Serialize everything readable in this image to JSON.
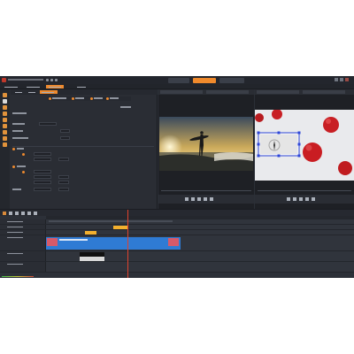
{
  "app": {
    "title": "",
    "top_tabs": [
      {
        "label": "",
        "active": false
      },
      {
        "label": "",
        "active": true
      },
      {
        "label": "",
        "active": false
      }
    ],
    "accent_color": "#ee8a2e"
  },
  "left_panel": {
    "tabs": [
      {
        "label": ""
      },
      {
        "label": ""
      },
      {
        "label": ""
      },
      {
        "label": ""
      }
    ],
    "subtabs": [
      {
        "label": ""
      },
      {
        "label": ""
      },
      {
        "label": ""
      }
    ]
  },
  "source_preview": {
    "tabs": [
      {
        "label": ""
      },
      {
        "label": ""
      }
    ],
    "image": "surfer-silhouette-sunset-ocean"
  },
  "effect_preview": {
    "tabs": [
      {
        "label": ""
      },
      {
        "label": ""
      }
    ],
    "image": "red-christmas-ornaments-with-selection-box"
  },
  "timeline": {
    "tracks": [
      {
        "name": ""
      },
      {
        "name": ""
      },
      {
        "name": ""
      },
      {
        "name": ""
      },
      {
        "name": ""
      },
      {
        "name": ""
      }
    ]
  }
}
